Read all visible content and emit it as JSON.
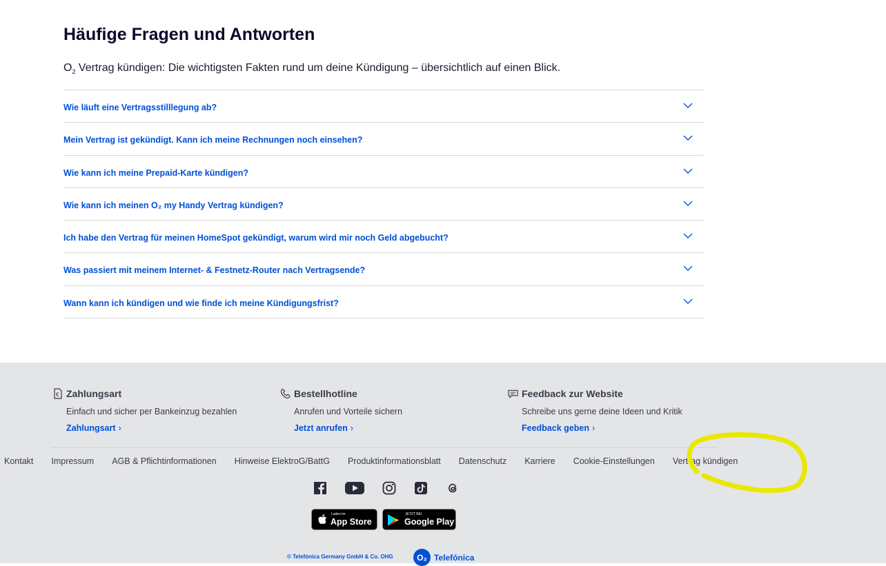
{
  "faq": {
    "title": "Häufige Fragen und Antworten",
    "intro_prefix": "O",
    "intro_sub": "2",
    "intro_text": " Vertrag kündigen: Die wichtigsten Fakten rund um deine Kündigung – übersichtlich auf einen Blick.",
    "items": [
      "Wie läuft eine Vertragsstilllegung ab?",
      "Mein Vertrag ist gekündigt. Kann ich meine Rechnungen noch einsehen?",
      "Wie kann ich meine Prepaid-Karte kündigen?",
      "Wie kann ich meinen O₂ my Handy Vertrag kündigen?",
      "Ich habe den Vertrag für meinen HomeSpot gekündigt, warum wird mir noch Geld abgebucht?",
      "Was passiert mit meinem Internet- & Festnetz-Router nach Vertragsende?",
      "Wann kann ich kündigen und wie finde ich meine Kündigungsfrist?"
    ]
  },
  "footer": {
    "columns": [
      {
        "icon": "euro-document-icon",
        "title": "Zahlungsart",
        "desc": "Einfach und sicher per Bankeinzug bezahlen",
        "link": "Zahlungsart"
      },
      {
        "icon": "phone-icon",
        "title": "Bestellhotline",
        "desc": "Anrufen und Vorteile sichern",
        "link": "Jetzt anrufen"
      },
      {
        "icon": "chat-icon",
        "title": "Feedback zur Website",
        "desc": "Schreibe uns gerne deine Ideen und Kritik",
        "link": "Feedback geben"
      }
    ],
    "links": [
      "Kontakt",
      "Impressum",
      "AGB & Pflichtinformationen",
      "Hinweise ElektroG/BattG",
      "Produktinformationsblatt",
      "Datenschutz",
      "Karriere",
      "Cookie-Einstellungen",
      "Vertrag kündigen"
    ],
    "social": [
      "facebook-icon",
      "youtube-icon",
      "instagram-icon",
      "tiktok-icon",
      "threads-icon"
    ],
    "badges": {
      "apple_small": "Laden im",
      "apple_big": "App Store",
      "google_small": "JETZT BEI",
      "google_big": "Google Play"
    },
    "copyright": "© Telefónica Germany GmbH & Co. OHG",
    "brand_logo": "O₂",
    "brand_name": "Telefónica"
  },
  "colors": {
    "link": "#0050d8",
    "footer_bg": "#e4e5e7",
    "highlight": "#e8e800"
  }
}
